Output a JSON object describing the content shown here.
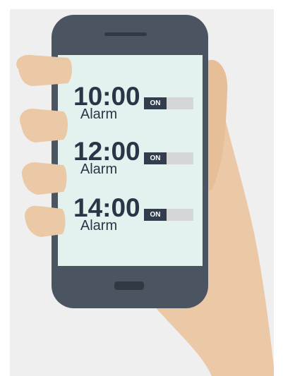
{
  "colors": {
    "background_panel": "#efefef",
    "skin": "#ecc9a6",
    "phone_body": "#4b5562",
    "screen": "#e3f2ef",
    "text_dark": "#2b3547",
    "toggle_on": "#323e4d",
    "toggle_track": "#d4d6d7"
  },
  "alarms": [
    {
      "time": "10:00",
      "label": "Alarm",
      "toggle": "ON"
    },
    {
      "time": "12:00",
      "label": "Alarm",
      "toggle": "ON"
    },
    {
      "time": "14:00",
      "label": "Alarm",
      "toggle": "ON"
    }
  ],
  "icons": {
    "speaker": "speaker-slot-icon",
    "home_button": "home-button-icon"
  }
}
